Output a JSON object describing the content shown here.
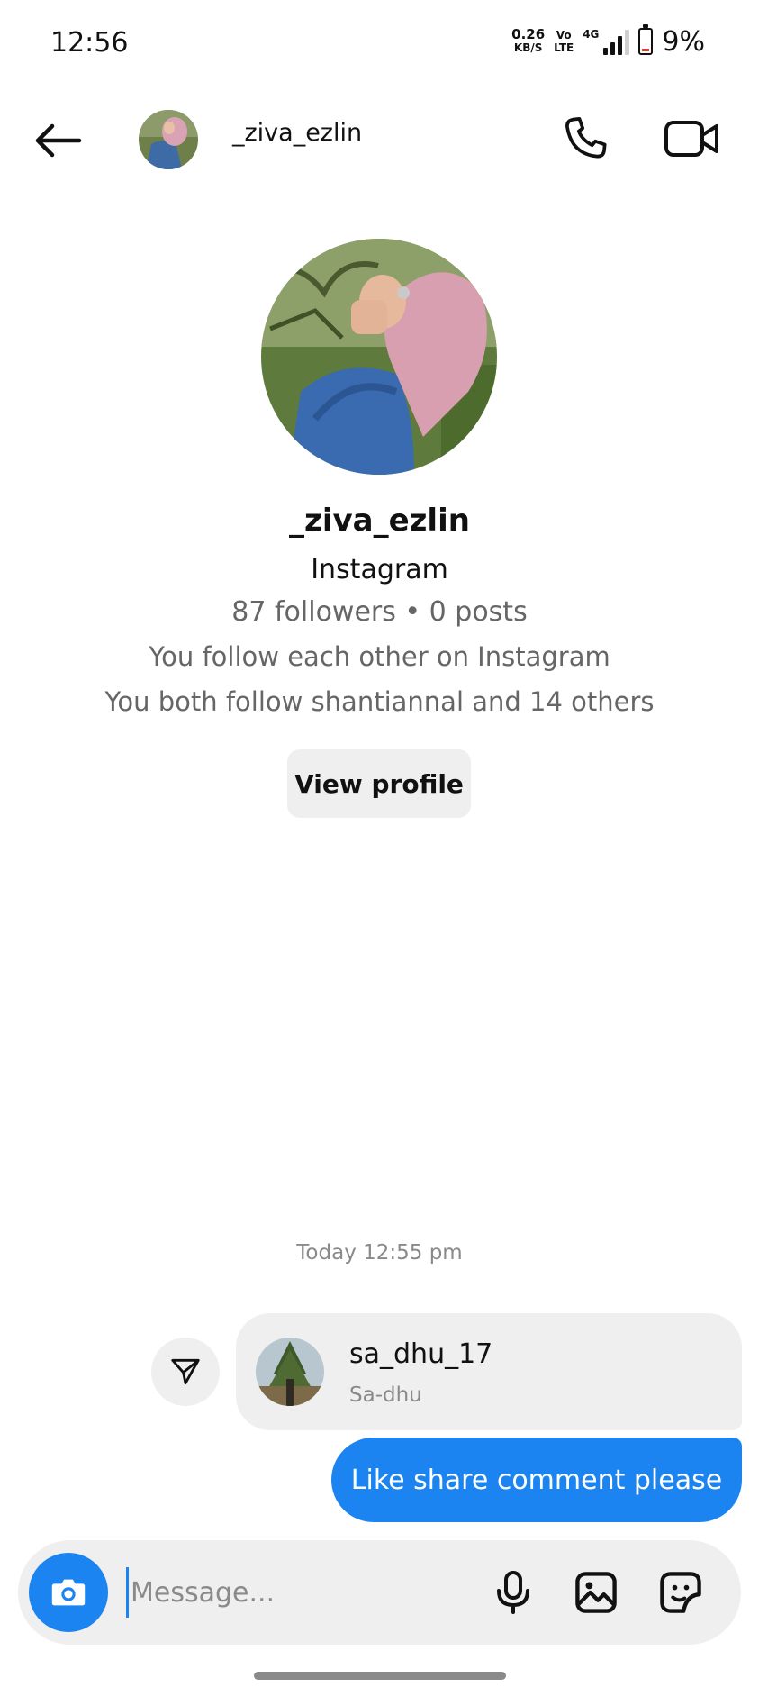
{
  "status_bar": {
    "time": "12:56",
    "network_speed_value": "0.26",
    "network_speed_unit": "KB/S",
    "volte_top": "Vo",
    "volte_bottom": "LTE",
    "network_type": "4G",
    "battery_percent": "9%",
    "battery_level": 0.09
  },
  "header": {
    "username": "_ziva_ezlin",
    "back_icon": "arrow-left-icon",
    "call_icon": "phone-icon",
    "video_icon": "video-camera-icon"
  },
  "profile": {
    "name": "_ziva_ezlin",
    "platform": "Instagram",
    "stats": "87 followers • 0 posts",
    "mutual": "You follow each other on Instagram",
    "common": "You both follow shantiannal and 14 others",
    "view_button": "View profile"
  },
  "chat": {
    "timestamp": "Today 12:55 pm",
    "shared_profile": {
      "username": "sa_dhu_17",
      "full_name": "Sa-dhu"
    },
    "share_icon": "send-icon",
    "outgoing_message": "Like share comment please"
  },
  "composer": {
    "placeholder": "Message...",
    "camera_icon": "camera-icon",
    "mic_icon": "microphone-icon",
    "gallery_icon": "image-icon",
    "sticker_icon": "sticker-icon"
  },
  "colors": {
    "accent": "#1b84f0",
    "bubble_gray": "#efefef",
    "muted_text": "#8a8a8a"
  }
}
